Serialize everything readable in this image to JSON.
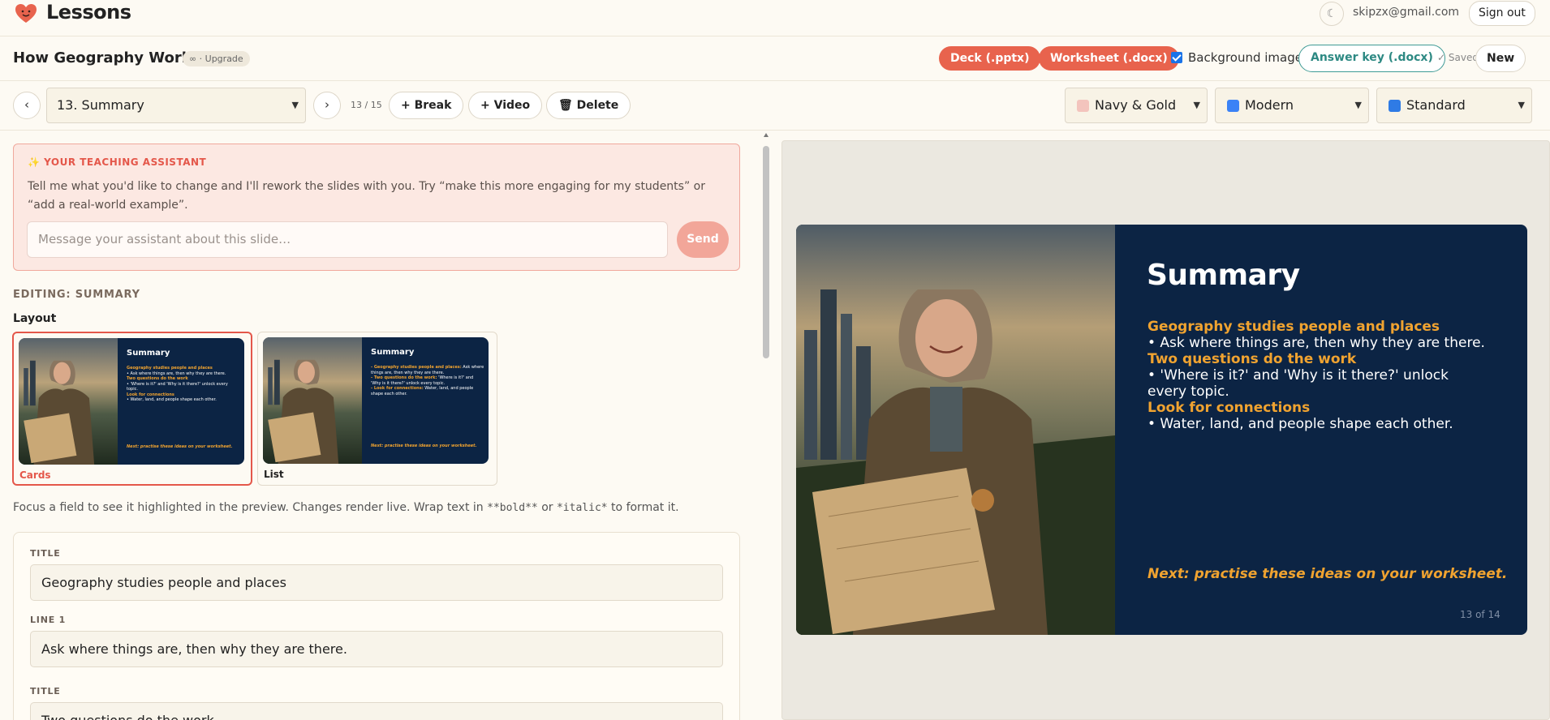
{
  "app": {
    "brand": "Lessons",
    "theme_toggle_glyph": "☾",
    "user_email": "skipzx@gmail.com",
    "sign_out": "Sign out"
  },
  "doc": {
    "title": "How Geography Works",
    "upgrade": "∞ · Upgrade",
    "deck": "Deck (.pptx)",
    "worksheet": "Worksheet (.docx)",
    "background_image_label": "Background image",
    "background_image_checked": true,
    "answer_key": "Answer key (.docx)",
    "saved": "✓ Saved",
    "new": "New"
  },
  "toolbar": {
    "prev": "‹",
    "next": "›",
    "slide_select": "13. Summary",
    "counter": "13 / 15",
    "break": "+ Break",
    "video": "+ Video",
    "delete": "🗑 Delete",
    "palette": "Navy & Gold",
    "font": "Modern",
    "accessibility": "Standard"
  },
  "assistant": {
    "title": "✨ YOUR TEACHING ASSISTANT",
    "text": "Tell me what you'd like to change and I'll rework the slides with you. Try “make this more engaging for my students” or “add a real-world example”.",
    "placeholder": "Message your assistant about this slide…",
    "send": "Send"
  },
  "editor": {
    "editing": "EDITING: SUMMARY",
    "layout": "Layout",
    "layouts": [
      {
        "label": "Cards",
        "selected": true
      },
      {
        "label": "List",
        "selected": false
      }
    ],
    "hint_pre": "Focus a field to see it highlighted in the preview. Changes render live. Wrap text in ",
    "hint_bold": "**bold**",
    "hint_mid": " or ",
    "hint_italic": "*italic*",
    "hint_post": " to format it.",
    "fields": [
      {
        "label": "TITLE",
        "value": "Geography studies people and places"
      },
      {
        "label": "LINE 1",
        "value": "Ask where things are, then why they are there."
      },
      {
        "label": "TITLE",
        "value": "Two questions do the work"
      }
    ]
  },
  "slide": {
    "title": "Summary",
    "h1": "Geography studies people and places",
    "l1": "• Ask where things are, then why they are there.",
    "h2": "Two questions do the work",
    "l2": "• 'Where is it?' and 'Why is it there?' unlock every topic.",
    "h3": "Look for connections",
    "l3": "• Water, land, and people shape each other.",
    "next": "Next: practise these ideas on your worksheet.",
    "page": "13 of 14"
  },
  "mini_list": {
    "b1a": "- Geography studies people and places:",
    "b1b": " Ask where things are, then why they are there.",
    "b2a": "- Two questions do the work:",
    "b2b": " 'Where is it?' and 'Why is it there?' unlock every topic.",
    "b3a": "- Look for connections:",
    "b3b": " Water, land, and people shape each other."
  },
  "colors": {
    "accent": "#e8634d",
    "navy": "#0c2444",
    "gold": "#f0a330",
    "teal": "#2d8983"
  }
}
